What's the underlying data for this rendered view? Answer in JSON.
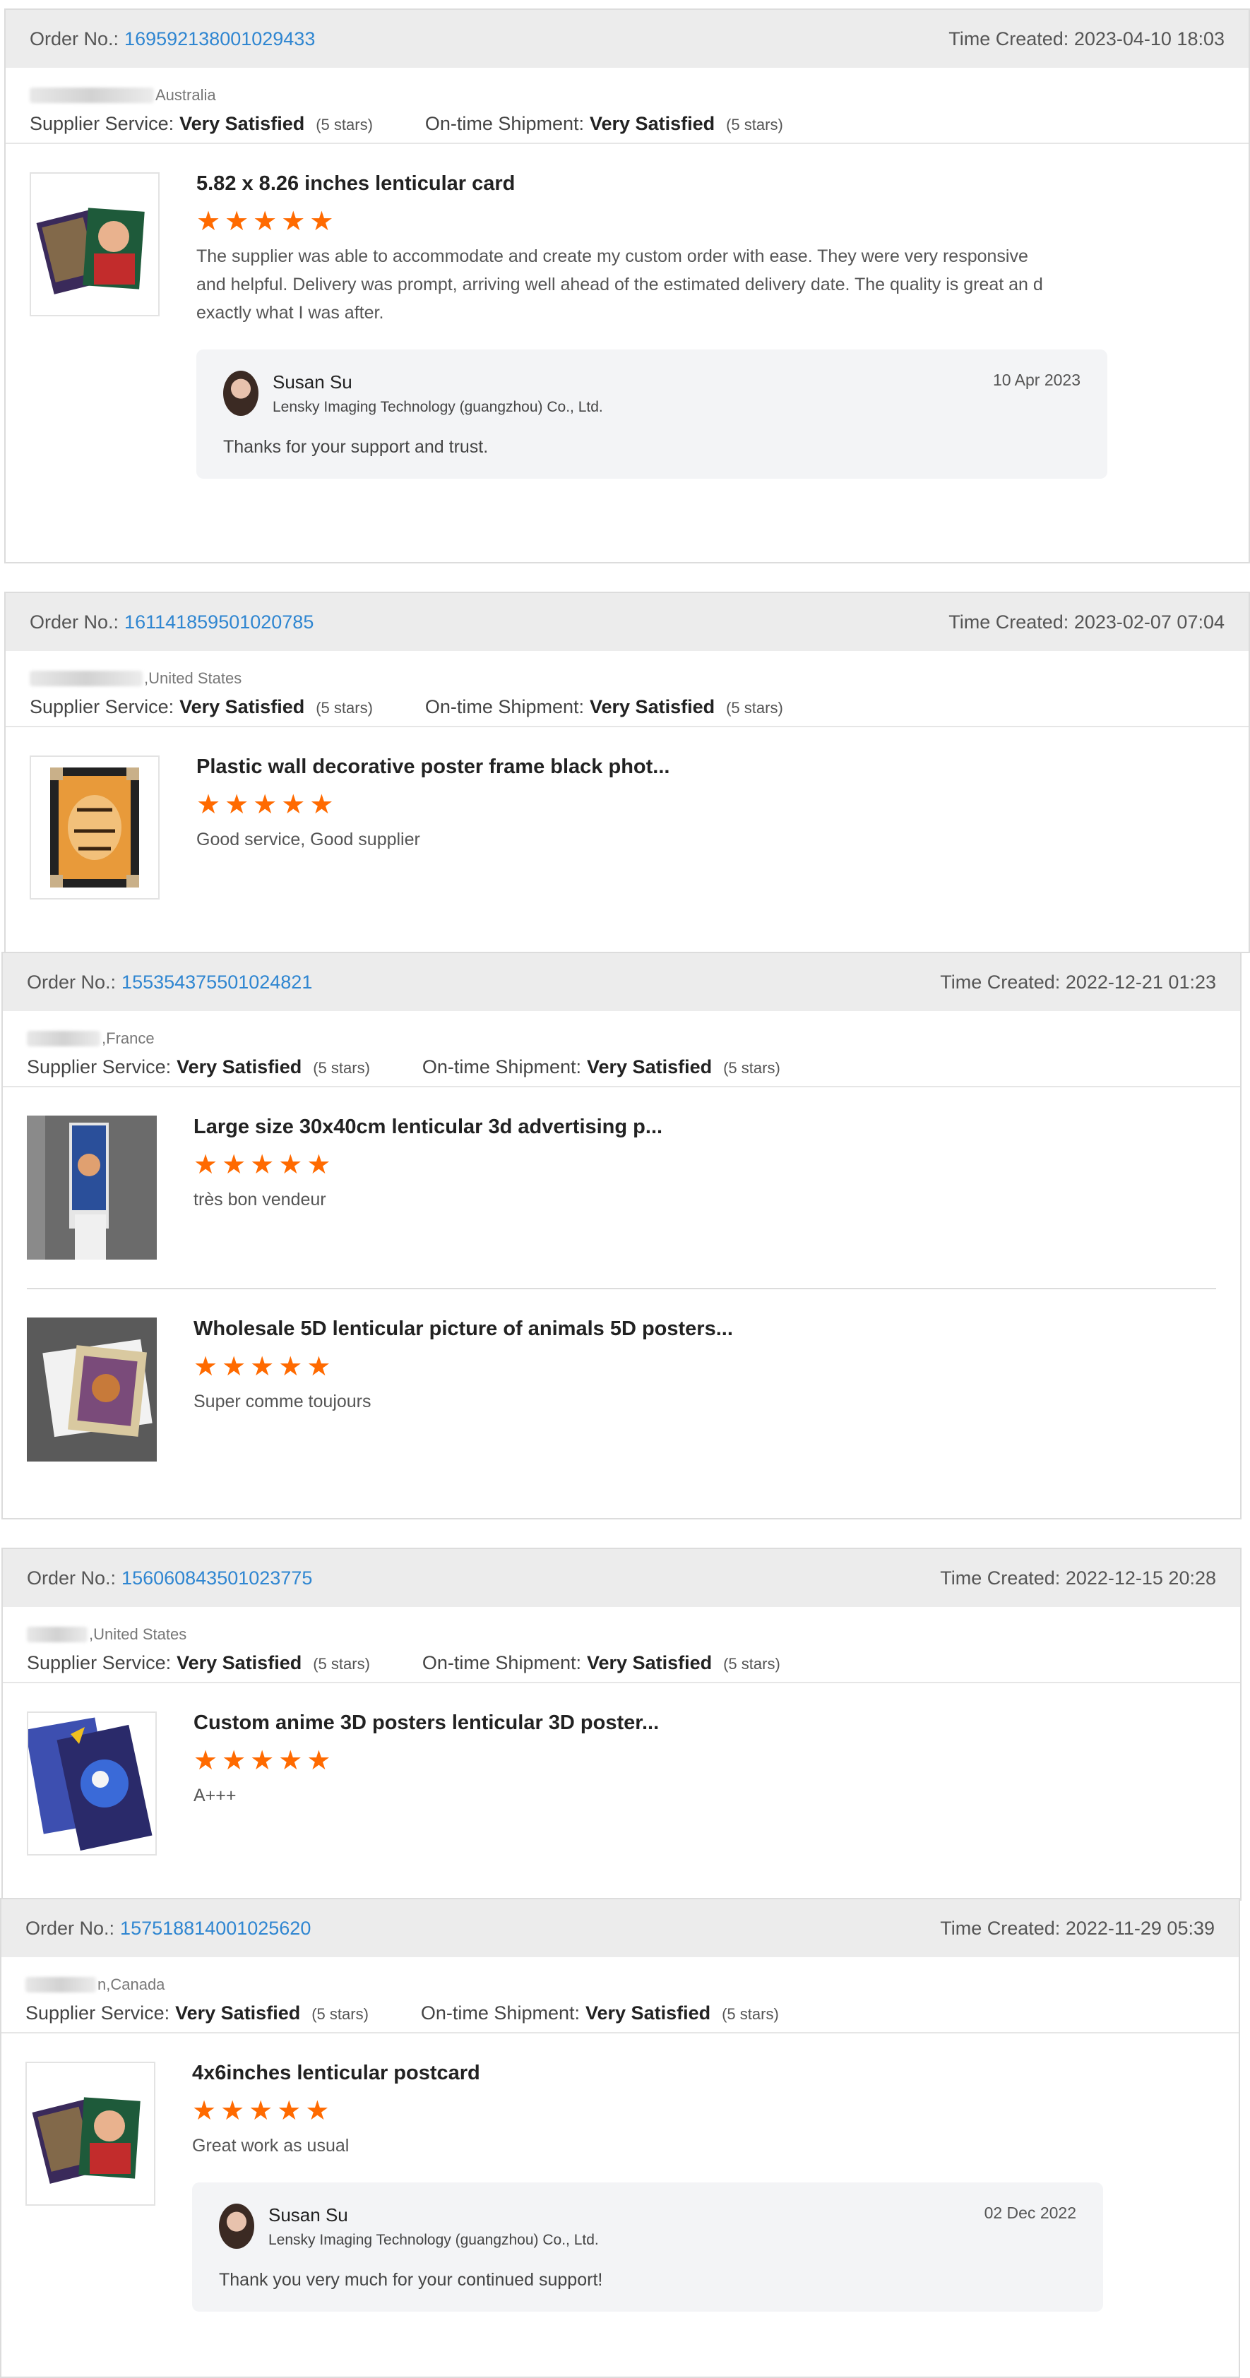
{
  "labels": {
    "order_no": "Order No.:",
    "time_created": "Time Created:",
    "supplier_service": "Supplier Service:",
    "on_time_shipment": "On-time Shipment:"
  },
  "colors": {
    "accent_link": "#2f86d1",
    "star": "#ff6a00",
    "header_bg": "#ececec"
  },
  "orders": [
    {
      "order_no": "169592138001029433",
      "time_created": "2023-04-10 18:03",
      "buyer_location": "Australia",
      "supplier_service": "Very Satisfied",
      "supplier_stars": "(5 stars)",
      "shipment": "Very Satisfied",
      "shipment_stars": "(5 stars)",
      "items": [
        {
          "title": "5.82 x 8.26 inches lenticular card",
          "rating": 5,
          "comment": "The supplier was able to accommodate and create my custom order with ease. They were very responsive and helpful. Delivery was prompt, arriving well ahead of the estimated delivery date. The quality is great an d exactly what I was after.",
          "thumb_icon": "joker-cards-image"
        }
      ],
      "reply": {
        "name": "Susan Su",
        "company": "Lensky Imaging Technology (guangzhou) Co., Ltd.",
        "date": "10 Apr 2023",
        "text": "Thanks for your support and trust."
      }
    },
    {
      "order_no": "161141859501020785",
      "time_created": "2023-02-07 07:04",
      "buyer_location": ",United States",
      "supplier_service": "Very Satisfied",
      "supplier_stars": "(5 stars)",
      "shipment": "Very Satisfied",
      "shipment_stars": "(5 stars)",
      "items": [
        {
          "title": "Plastic wall decorative poster frame black phot...",
          "rating": 5,
          "comment": "Good service, Good supplier",
          "thumb_icon": "tiger-frame-image"
        }
      ]
    },
    {
      "order_no": "155354375501024821",
      "time_created": "2022-12-21 01:23",
      "buyer_location": ",France",
      "supplier_service": "Very Satisfied",
      "supplier_stars": "(5 stars)",
      "shipment": "Very Satisfied",
      "shipment_stars": "(5 stars)",
      "items": [
        {
          "title": "Large size 30x40cm lenticular 3d advertising p...",
          "rating": 5,
          "comment": "très bon vendeur",
          "thumb_icon": "poster-photo-image"
        },
        {
          "title": "Wholesale 5D lenticular picture of animals 5D posters...",
          "rating": 5,
          "comment": "Super comme toujours",
          "thumb_icon": "animal-picture-image"
        }
      ]
    },
    {
      "order_no": "156060843501023775",
      "time_created": "2022-12-15 20:28",
      "buyer_location": ",United States",
      "supplier_service": "Very Satisfied",
      "supplier_stars": "(5 stars)",
      "shipment": "Very Satisfied",
      "shipment_stars": "(5 stars)",
      "items": [
        {
          "title": "Custom anime 3D posters lenticular 3D poster...",
          "rating": 5,
          "comment": "A+++",
          "thumb_icon": "anime-poster-image"
        }
      ]
    },
    {
      "order_no": "157518814001025620",
      "time_created": "2022-11-29 05:39",
      "buyer_location": "n,Canada",
      "supplier_service": "Very Satisfied",
      "supplier_stars": "(5 stars)",
      "shipment": "Very Satisfied",
      "shipment_stars": "(5 stars)",
      "items": [
        {
          "title": "4x6inches lenticular postcard",
          "rating": 5,
          "comment": "Great work as usual",
          "thumb_icon": "joker-cards-image"
        }
      ],
      "reply": {
        "name": "Susan Su",
        "company": "Lensky Imaging Technology (guangzhou) Co., Ltd.",
        "date": "02 Dec 2022",
        "text": "Thank you very much for your continued support!"
      }
    }
  ]
}
